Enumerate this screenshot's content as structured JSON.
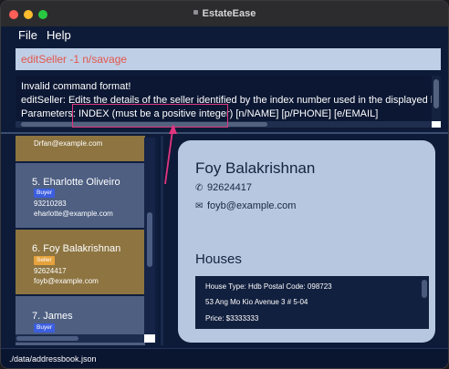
{
  "window": {
    "title": "EstateEase",
    "traffic_lights": [
      "#fe5f57",
      "#febc2e",
      "#28c840"
    ]
  },
  "menu": {
    "file": "File",
    "help": "Help"
  },
  "command": {
    "value": "editSeller -1 n/savage"
  },
  "result": {
    "line1": "Invalid command format!",
    "line2": "editSeller: Edits the details of the seller identified by the index number used in the displayed list. I",
    "line3": "Parameters: INDEX (must be a positive integer) [n/NAME] [p/PHONE] [e/EMAIL]"
  },
  "list": {
    "top_partial_email": "Drfan@example.com",
    "cards": [
      {
        "name": "5.  Eharlotte Oliveiro",
        "tag": "Buyer",
        "phone": "93210283",
        "email": "eharlotte@example.com"
      },
      {
        "name": "6.  Foy Balakrishnan",
        "tag": "Seller",
        "phone": "92624417",
        "email": "foyb@example.com"
      },
      {
        "name": "7.  James",
        "tag": "Buyer"
      }
    ]
  },
  "detail": {
    "name": "Foy Balakrishnan",
    "phone": "92624417",
    "email": "foyb@example.com",
    "houses_heading": "Houses",
    "house": {
      "type_line": "House Type: Hdb    Postal Code: 098723",
      "address": "53 Ang Mo Kio Avenue 3 # 5-04",
      "price": "Price: $3333333"
    }
  },
  "status": {
    "path": "./data/addressbook.json"
  },
  "colors": {
    "buyer_tag": "#3c5ee0",
    "seller_tag": "#e6a23c",
    "selected_card": "#8d7440",
    "card": "#4e5f82",
    "highlight": "#e0357f",
    "command_text": "#e3574c"
  },
  "icons": {
    "phone": "phone-icon",
    "email": "envelope-icon"
  }
}
